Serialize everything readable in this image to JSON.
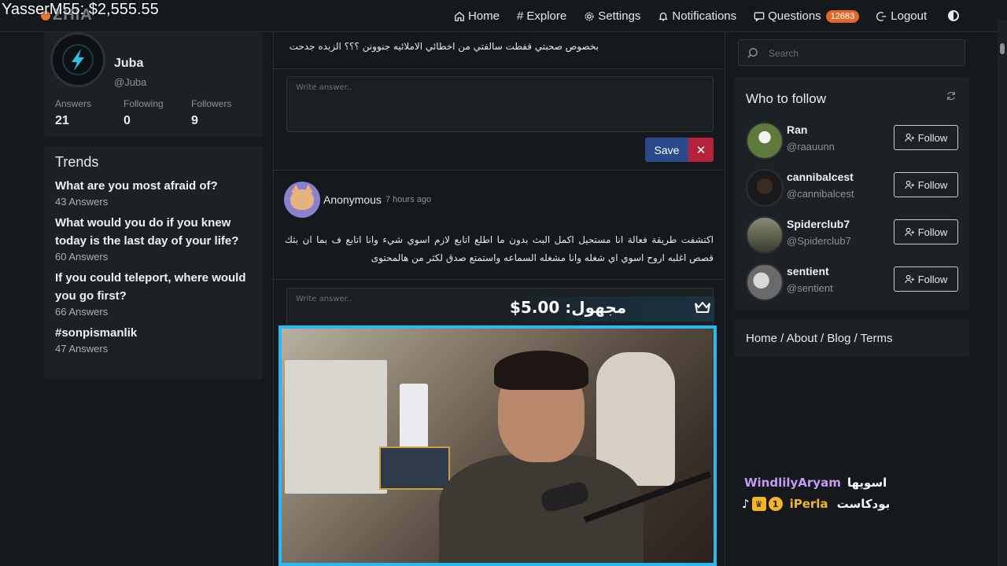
{
  "overlay": {
    "money": "YasserM55: $2,555.55"
  },
  "nav": {
    "logo": "ZHIA",
    "items": [
      {
        "label": "Home",
        "icon": "home-icon"
      },
      {
        "label": "Explore",
        "icon": "hashtag-icon"
      },
      {
        "label": "Settings",
        "icon": "gear-icon"
      },
      {
        "label": "Notifications",
        "icon": "bell-icon"
      },
      {
        "label": "Questions",
        "icon": "chat-icon",
        "badge": "12683"
      },
      {
        "label": "Logout",
        "icon": "logout-icon"
      }
    ],
    "theme_icon": "contrast-icon"
  },
  "profile": {
    "name": "Juba",
    "handle": "@Juba",
    "stats": [
      {
        "label": "Answers",
        "value": "21"
      },
      {
        "label": "Following",
        "value": "0"
      },
      {
        "label": "Followers",
        "value": "9"
      }
    ]
  },
  "trends": {
    "title": "Trends",
    "items": [
      {
        "q": "What are you most afraid of?",
        "a": "43 Answers"
      },
      {
        "q": "What would you do if you knew today is the last day of your life?",
        "a": "60 Answers"
      },
      {
        "q": "If you could teleport, where would you go first?",
        "a": "66 Answers"
      },
      {
        "q": "#sonpismanlik",
        "a": "47 Answers"
      }
    ]
  },
  "feed": {
    "q1_text": "بخصوص صحبتي قفطت سالفتي من اخطائي الاملائيه جنوونن ؟؟؟ الزبده جدحت",
    "answer_placeholder": "Write answer..",
    "save_label": "Save",
    "cancel_label": "✕",
    "post2": {
      "author": "Anonymous",
      "time": "7 hours ago",
      "text": "اكتشفت طريقة فعالة انا مستحيل اكمل البث بدون ما اطلع اتابع لازم اسوي شيء وانا اتابع ف بما ان بثك قصص اغلبه اروح اسوي اي شغله وانا مشغله السماعه واستمتع صدق لكثر من هالمحتوى"
    }
  },
  "donation": {
    "text": "مجهول: 5.00$",
    "icon": "crown-icon"
  },
  "search": {
    "placeholder": "Search"
  },
  "who_to_follow": {
    "title": "Who to follow",
    "refresh_icon": "refresh-icon",
    "users": [
      {
        "name": "Ran",
        "handle": "@raauunn",
        "button": "Follow"
      },
      {
        "name": "cannibalcest",
        "handle": "@cannibalcest",
        "button": "Follow"
      },
      {
        "name": "Spiderclub7",
        "handle": "@Spiderclub7",
        "button": "Follow"
      },
      {
        "name": "sentient",
        "handle": "@sentient",
        "button": "Follow"
      }
    ]
  },
  "footer_links": {
    "text": "Home / About / Blog / Terms"
  },
  "chat": [
    {
      "user": "WindlilyAryam",
      "message": "اسويها"
    },
    {
      "user": "iPerla",
      "message": "بودكاست",
      "badge_level": "1"
    }
  ],
  "colors": {
    "accent": "#2bb8f0",
    "save": "#2b4a8c",
    "cancel": "#b5233a",
    "badge": "#e06a2a"
  }
}
